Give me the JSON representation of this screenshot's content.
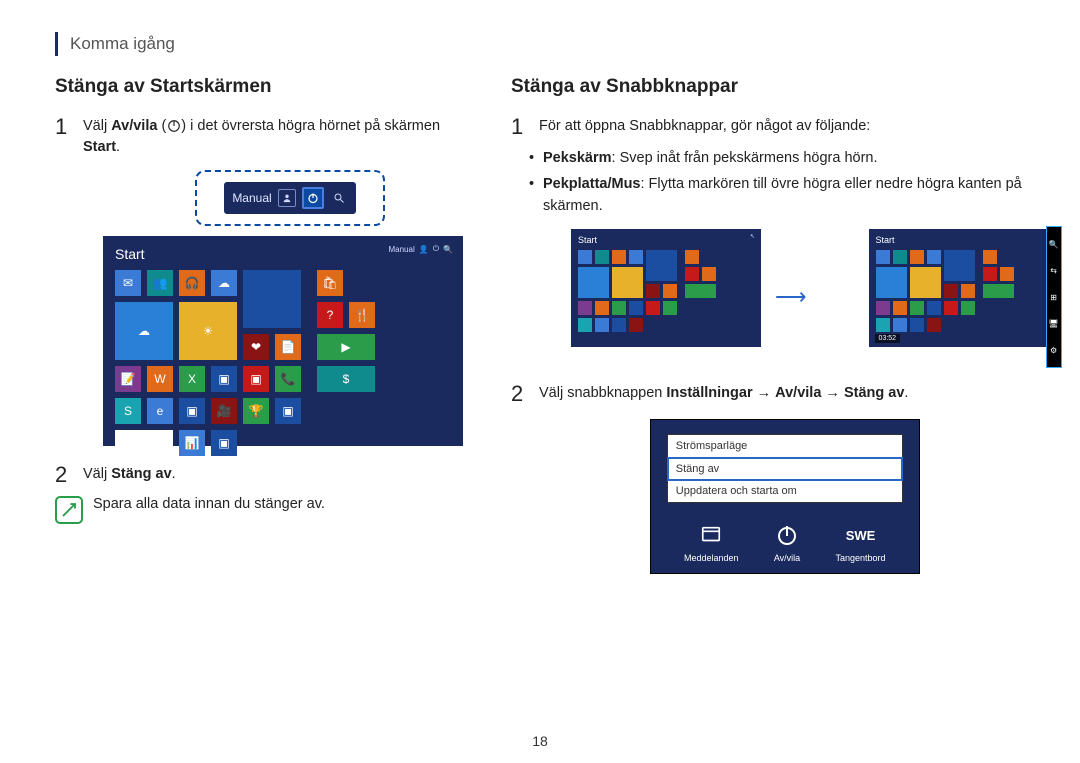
{
  "header": {
    "title": "Komma igång"
  },
  "page_number": "18",
  "left": {
    "heading": "Stänga av Startskärmen",
    "step1_a": "Välj ",
    "step1_bold1": "Av/vila",
    "step1_b": " (",
    "step1_c": ") i det övrersta högra hörnet på skärmen ",
    "step1_bold2": "Start",
    "step1_d": ".",
    "callout_label": "Manual",
    "start_label": "Start",
    "start_user": "Manual",
    "step2_a": "Välj ",
    "step2_bold": "Stäng av",
    "step2_b": ".",
    "note": "Spara alla data innan du stänger av."
  },
  "right": {
    "heading": "Stänga av Snabbknappar",
    "step1": "För att öppna Snabbknappar, gör något av följande:",
    "b1_bold": "Pekskärm",
    "b1_rest": ": Svep inåt från pekskärmens högra hörn.",
    "b2_bold": "Pekplatta/Mus",
    "b2_rest": ": Flytta markören till övre högra eller nedre högra kanten på skärmen.",
    "start_label_s": "Start",
    "clock": "03:52",
    "step2_a": "Välj snabbknappen ",
    "step2_bold1": "Inställningar",
    "step2_arrow": " → ",
    "step2_bold2": "Av/vila",
    "step2_bold3": "Stäng av",
    "step2_end": ".",
    "menu": {
      "i1": "Strömsparläge",
      "i2": "Stäng av",
      "i3": "Uppdatera och starta om"
    },
    "bottom": {
      "l1": "Meddelanden",
      "l2": "Av/vila",
      "l3": "Tangentbord",
      "swe": "SWE"
    }
  }
}
